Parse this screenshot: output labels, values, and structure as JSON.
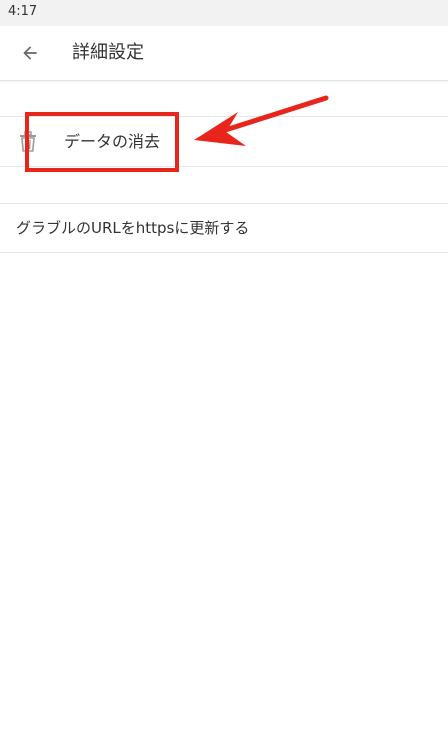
{
  "status_bar": {
    "time": "4:17"
  },
  "app_bar": {
    "back_icon": "arrow-back-icon",
    "title": "詳細設定"
  },
  "settings": {
    "items": [
      {
        "icon": "trash-icon",
        "label": "データの消去"
      },
      {
        "label": "グラブルのURLをhttpsに更新する"
      }
    ]
  },
  "annotation": {
    "color": "#e8251b"
  }
}
